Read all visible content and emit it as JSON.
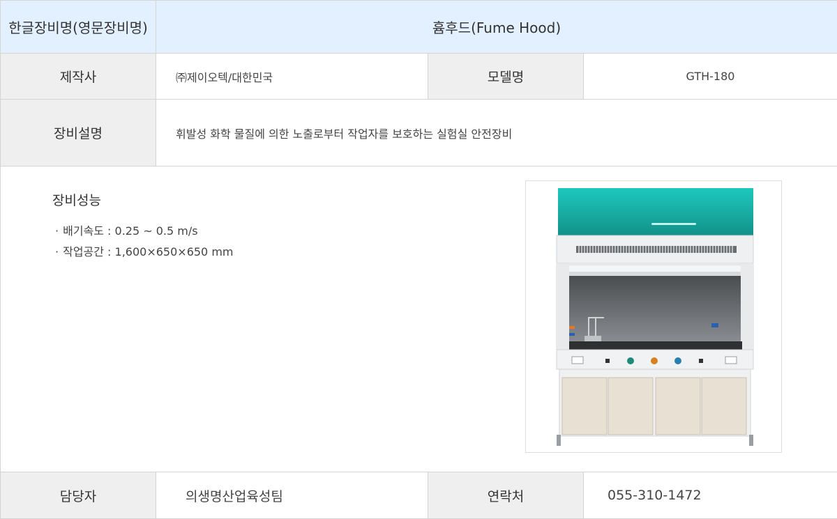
{
  "header": {
    "label": "한글장비명(영문장비명)",
    "value": "흄후드(Fume Hood)"
  },
  "maker": {
    "label": "제작사",
    "value": "㈜제이오텍/대한민국"
  },
  "model": {
    "label": "모델명",
    "value": "GTH-180"
  },
  "description": {
    "label": "장비설명",
    "value": "휘발성 화학 물질에 의한 노출로부터 작업자를 보호하는 실험실 안전장비"
  },
  "performance": {
    "title": "장비성능",
    "items": [
      {
        "bullet": "·",
        "text": "배기속도 : 0.25 ~ 0.5 m/s"
      },
      {
        "bullet": "·",
        "text": "작업공간 : 1,600×650×650 mm"
      }
    ]
  },
  "photo": {
    "icon": "fume-hood-photo",
    "colors": {
      "canopy": "#1fb5ad",
      "body": "#e9ecee",
      "cabinet": "#e8e0d2"
    }
  },
  "manager": {
    "label": "담당자",
    "value": "의생명산업육성팀"
  },
  "contact": {
    "label": "연락처",
    "value": "055-310-1472"
  },
  "colors": {
    "header_bg": "#e3f0ff",
    "label_bg": "#efefef",
    "border": "#d4d4d4"
  }
}
